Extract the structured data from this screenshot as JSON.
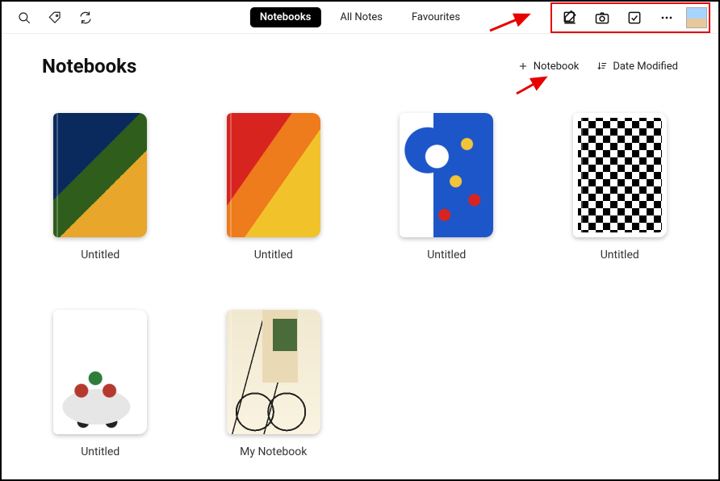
{
  "nav": {
    "tabs": [
      {
        "label": "Notebooks",
        "active": true
      },
      {
        "label": "All Notes",
        "active": false
      },
      {
        "label": "Favourites",
        "active": false
      }
    ]
  },
  "page": {
    "title": "Notebooks",
    "add_label": "Notebook",
    "sort_label": "Date Modified"
  },
  "notebooks": [
    {
      "name": "Untitled"
    },
    {
      "name": "Untitled"
    },
    {
      "name": "Untitled"
    },
    {
      "name": "Untitled"
    },
    {
      "name": "Untitled"
    },
    {
      "name": "My Notebook"
    }
  ]
}
